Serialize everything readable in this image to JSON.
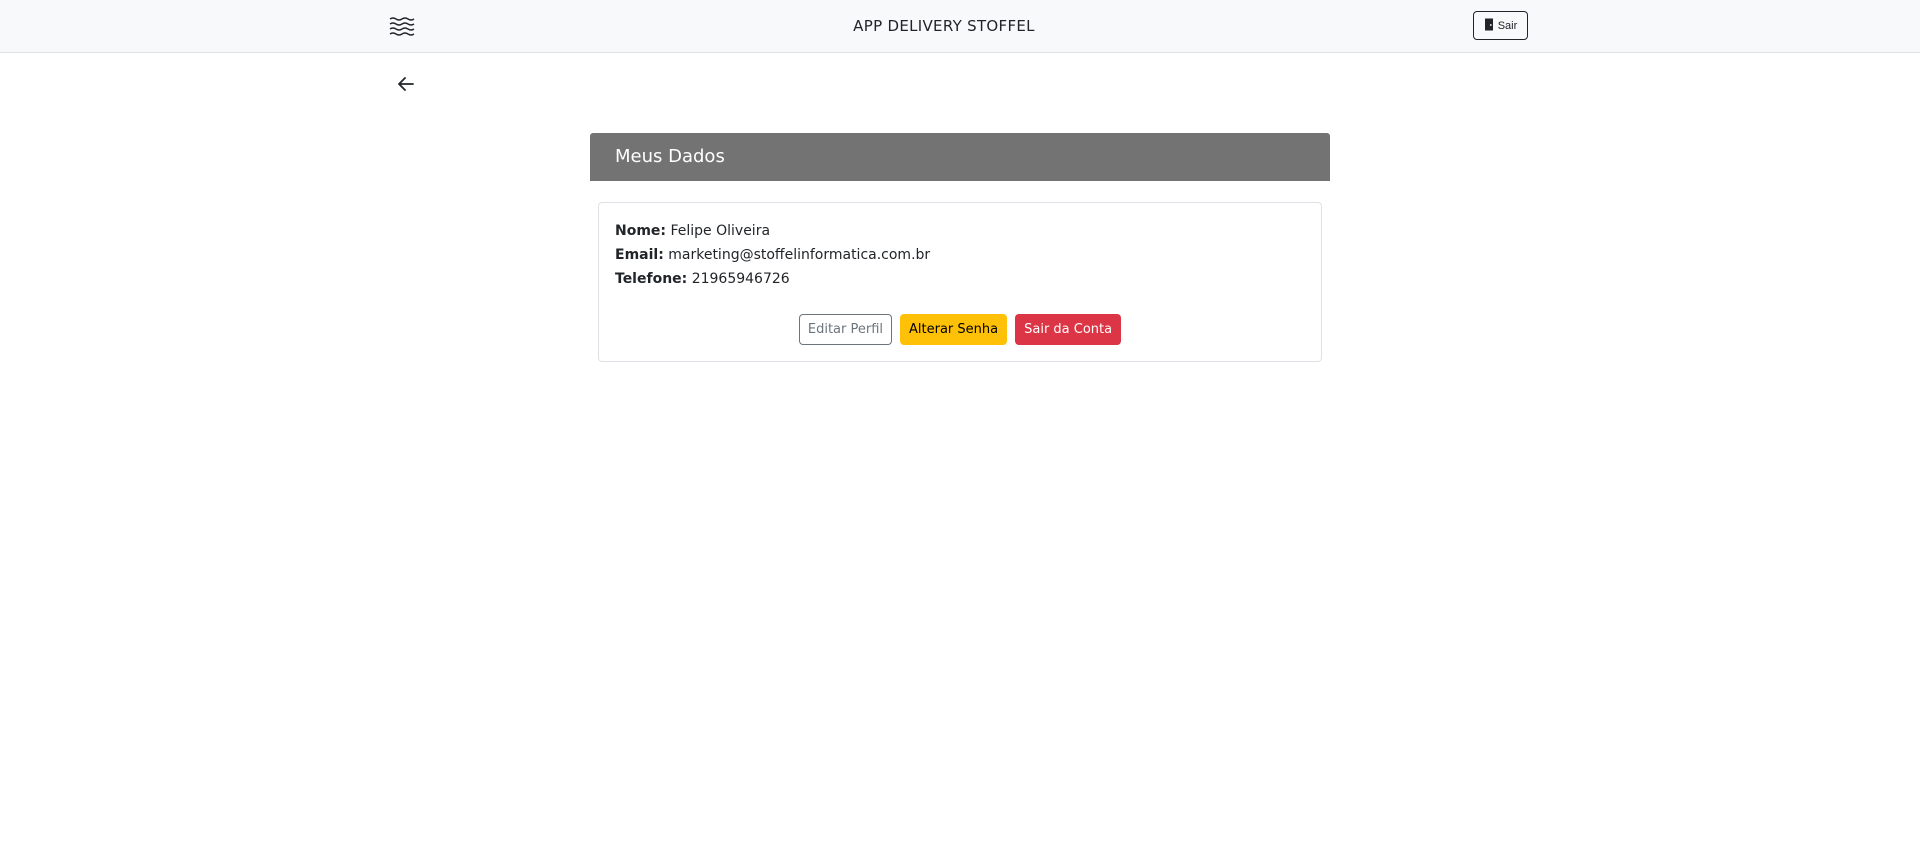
{
  "navbar": {
    "menu_icon": "menu-lines-icon",
    "brand": "APP DELIVERY STOFFEL",
    "logout_label": "Sair",
    "logout_icon": "door-icon"
  },
  "back_icon": "arrow-left-icon",
  "profile": {
    "title": "Meus Dados",
    "fields": {
      "name_label": "Nome:",
      "name_value": "Felipe Oliveira",
      "email_label": "Email:",
      "email_value": "marketing@stoffelinformatica.com.br",
      "phone_label": "Telefone:",
      "phone_value": "21965946726"
    },
    "actions": {
      "edit_label": "Editar Perfil",
      "password_label": "Alterar Senha",
      "logout_label": "Sair da Conta"
    }
  },
  "colors": {
    "header_bg": "#737373",
    "warning": "#ffc107",
    "danger": "#dc3545"
  }
}
